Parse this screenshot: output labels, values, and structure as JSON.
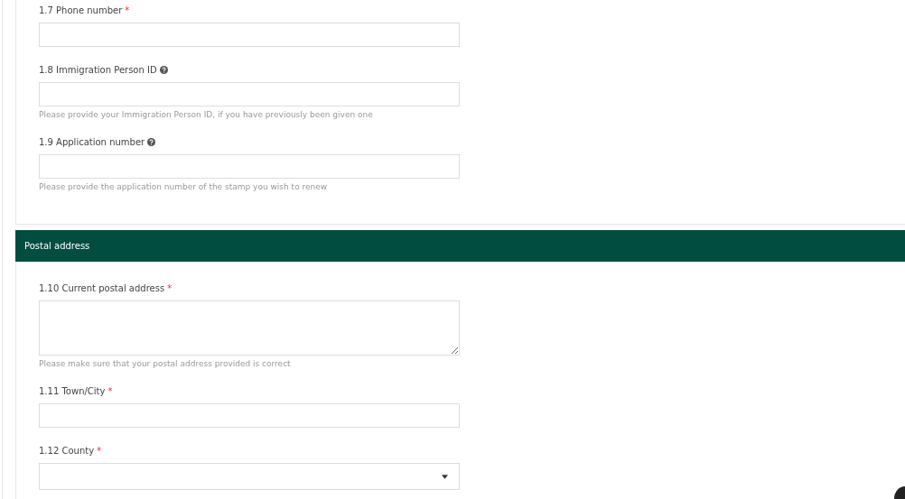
{
  "sections": [
    {
      "fields": [
        {
          "label": "1.7 Phone number",
          "required_mark": "*",
          "help": false,
          "kind": "text"
        },
        {
          "label": "1.8 Immigration Person ID",
          "help": true,
          "kind": "text",
          "hint": "Please provide your Immigration Person ID, if you have previously been given one"
        },
        {
          "label": "1.9 Application number",
          "help": true,
          "kind": "text",
          "hint": "Please provide the application number of the stamp you wish to renew"
        }
      ]
    },
    {
      "title": "Postal address",
      "fields": [
        {
          "label": "1.10 Current postal address",
          "required_mark": "*",
          "help": false,
          "kind": "textarea",
          "hint": "Please make sure that your postal address provided is correct"
        },
        {
          "label": "1.11 Town/City",
          "required_mark": "*",
          "help": false,
          "kind": "text"
        },
        {
          "label": "1.12 County",
          "required_mark": "*",
          "help": false,
          "kind": "select"
        }
      ]
    }
  ]
}
